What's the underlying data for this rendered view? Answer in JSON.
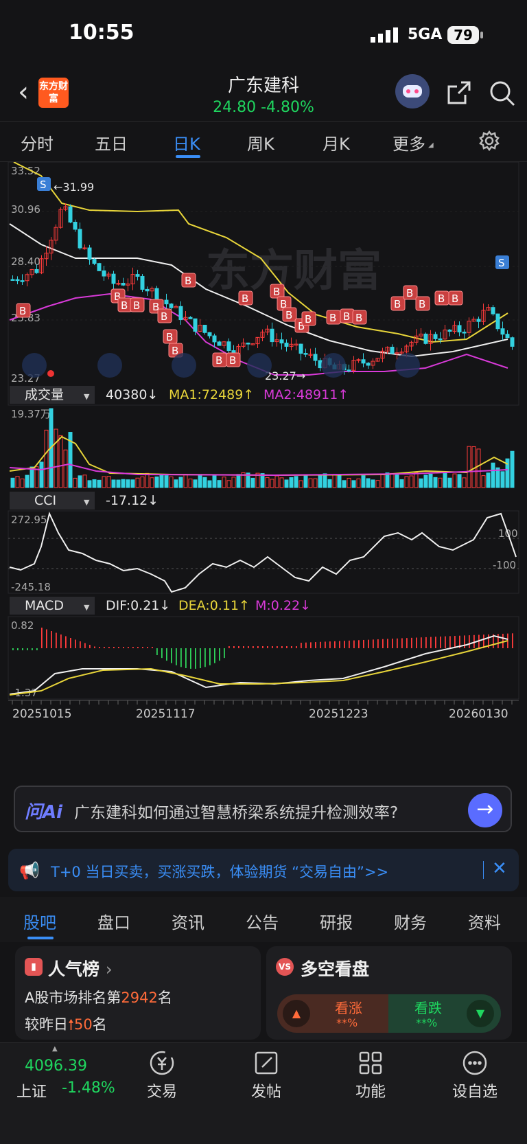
{
  "status": {
    "time": "10:55",
    "network": "5GA",
    "battery": "79"
  },
  "header": {
    "logo": "东方财富",
    "stock_name": "广东建科",
    "price_change": "24.80  -4.80%"
  },
  "tabs": [
    {
      "label": "分时"
    },
    {
      "label": "五日"
    },
    {
      "label": "日K"
    },
    {
      "label": "周K"
    },
    {
      "label": "月K"
    },
    {
      "label": "更多"
    }
  ],
  "chart_panel": {
    "price_axis": [
      "33.52",
      "30.96",
      "28.40",
      "25.83",
      "23.27"
    ],
    "high_marker": "31.99",
    "low_marker": "23.27",
    "watermark": "东方财富",
    "volume": {
      "selector": "成交量",
      "value": "40380",
      "ma1": "MA1:72489",
      "ma2": "MA2:48911",
      "max_label": "19.37万"
    },
    "cci": {
      "selector": "CCI",
      "value": "-17.12",
      "top": "272.95",
      "bottom": "-245.18",
      "ref_hi": "100",
      "ref_lo": "-100"
    },
    "macd": {
      "selector": "MACD",
      "dif": "DIF:0.21",
      "dea": "DEA:0.11",
      "m": "M:0.22",
      "top": "0.82",
      "bottom": "-1.37"
    },
    "dates": [
      "20251015",
      "20251117",
      "20251223",
      "20260130"
    ]
  },
  "chart_data": {
    "type": "candlestick",
    "ylim": [
      23.27,
      33.52
    ],
    "x": [
      "20251015",
      "20251117",
      "20251223",
      "20260130"
    ],
    "close_approx": [
      28.0,
      28.5,
      31.5,
      29.0,
      27.8,
      28.0,
      27.0,
      26.0,
      25.2,
      24.6,
      25.5,
      24.8,
      24.2,
      23.6,
      24.0,
      24.5,
      25.0,
      25.3,
      25.6,
      26.5,
      24.8
    ],
    "markers": {
      "S": 2,
      "B": 20
    },
    "current_price": 24.8,
    "change_pct": -4.8
  },
  "ai_bar": {
    "logo": "问Ai",
    "question": "广东建科如何通过智慧桥梁系统提升检测效率?"
  },
  "promo": {
    "text": "T+0 当日买卖，买涨买跌，体验期货 “交易自由”>>"
  },
  "bottom_tabs": [
    {
      "label": "股吧"
    },
    {
      "label": "盘口"
    },
    {
      "label": "资讯"
    },
    {
      "label": "公告"
    },
    {
      "label": "研报"
    },
    {
      "label": "财务"
    },
    {
      "label": "资料"
    }
  ],
  "popularity": {
    "title": "人气榜",
    "rank_prefix": "A股市场排名第",
    "rank": "2942",
    "rank_suffix": "名",
    "change_prefix": "较昨日",
    "change": "50",
    "change_suffix": "名"
  },
  "bull_bear": {
    "title": "多空看盘",
    "bull": "看涨",
    "bull_pct": "**%",
    "bear": "看跌",
    "bear_pct": "**%"
  },
  "nav": {
    "index_value": "4096.39",
    "index_name": "上证",
    "index_pct": "-1.48%",
    "trade": "交易",
    "post": "发帖",
    "function": "功能",
    "watchlist": "设自选"
  }
}
